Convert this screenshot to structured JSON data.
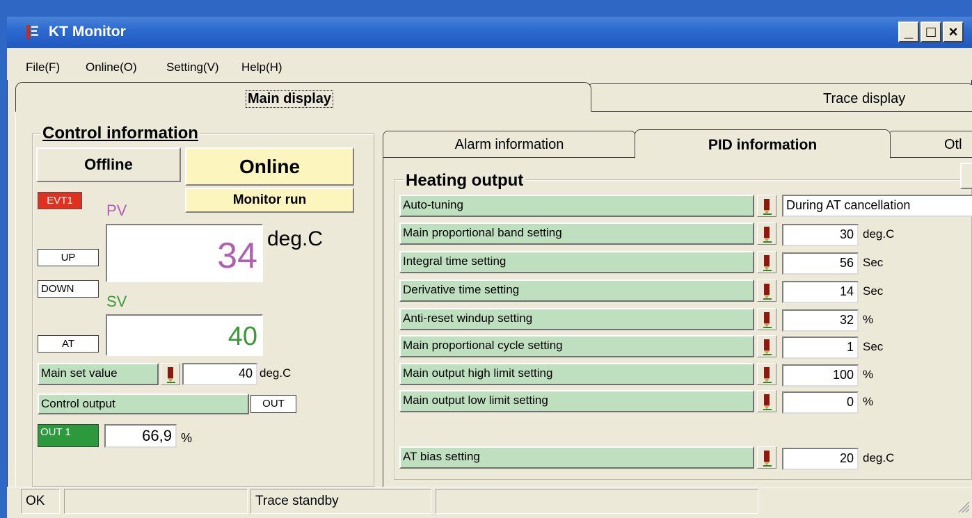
{
  "window": {
    "title": "KT Monitor"
  },
  "title_buttons": {
    "minimize": "_",
    "maximize": "□",
    "close": "×"
  },
  "menu": [
    "File(F)",
    "Online(O)",
    "Setting(V)",
    "Help(H)"
  ],
  "main_tabs": {
    "main": "Main display",
    "trace": "Trace display"
  },
  "control": {
    "title": "Control information",
    "offline": "Offline",
    "online": "Online",
    "monitor_run": "Monitor run",
    "evt1": "EVT1",
    "pv_label": "PV",
    "pv_value": "34",
    "pv_unit": "deg.C",
    "up": "UP",
    "down": "DOWN",
    "sv_label": "SV",
    "sv_value": "40",
    "at": "AT",
    "main_set_label": "Main set value",
    "main_set_value": "40",
    "main_set_unit": "deg.C",
    "control_output_label": "Control output",
    "out_btn": "OUT",
    "out1": "OUT 1",
    "out1_value": "66,9",
    "out1_unit": "%"
  },
  "sub_tabs": {
    "alarm": "Alarm information",
    "pid": "PID information",
    "other": "Otl"
  },
  "heating": {
    "title": "Heating output",
    "autotuning": {
      "label": "Auto-tuning",
      "value": "During AT cancellation"
    },
    "rows": [
      {
        "label": "Main proportional band setting",
        "value": "30",
        "unit": "deg.C"
      },
      {
        "label": "Integral time setting",
        "value": "56",
        "unit": "Sec"
      },
      {
        "label": "Derivative time setting",
        "value": "14",
        "unit": "Sec"
      },
      {
        "label": "Anti-reset windup setting",
        "value": "32",
        "unit": "%"
      },
      {
        "label": "Main proportional cycle setting",
        "value": "1",
        "unit": "Sec"
      },
      {
        "label": "Main output high limit setting",
        "value": "100",
        "unit": "%"
      },
      {
        "label": "Main output low limit setting",
        "value": "0",
        "unit": "%"
      }
    ],
    "at_bias": {
      "label": "AT bias setting",
      "value": "20",
      "unit": "deg.C"
    }
  },
  "status": {
    "s1": "OK",
    "s2": "",
    "s3": "Trace standby",
    "s4": ""
  },
  "colors": {
    "pv": "#b060b0",
    "sv": "#3a9a3a",
    "evt1": "#e03020",
    "out1": "#2c9a3c",
    "highlight": "#fdf5be",
    "label_bg": "#bfe0bf"
  }
}
